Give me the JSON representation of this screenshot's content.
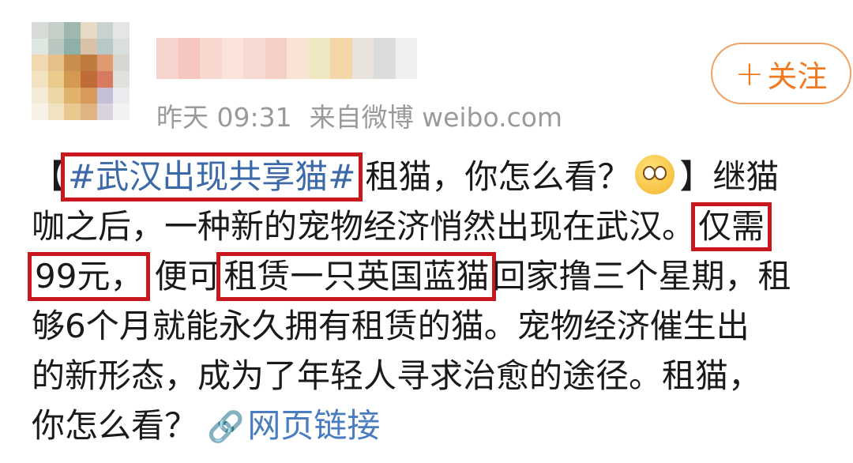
{
  "header": {
    "timestamp": "昨天 09:31",
    "source": "来自微博 weibo.com",
    "follow_label": "关注",
    "follow_plus": "+"
  },
  "post": {
    "bracket_open": "【",
    "topic": "#武汉出现共享猫#",
    "l1_rest": "租猫，你怎么看？",
    "bracket_close": "】继猫",
    "l2_text": "咖之后，一种新的宠物经济悄然出现在武汉。",
    "l2_box": "仅需",
    "l3_box1": "99元，",
    "l3_mid": "便可",
    "l3_box2": "租赁一只英国蓝猫",
    "l3_rest": "回家撸三个星期，租",
    "l4_text": "够6个月就能永久拥有租赁的猫。宠物经济催生出",
    "l5_text": "的新形态，成为了年轻人寻求治愈的途径。租猫，",
    "l6_text": "你怎么看？",
    "link_label": "网页链接"
  },
  "colors": {
    "topic": "#3c6aa8",
    "highlight_box": "#c8181e",
    "follow": "#f07a20",
    "meta": "#9a9a9a"
  },
  "icons": {
    "emoji": "thinking-emoji",
    "link": "link-icon"
  }
}
